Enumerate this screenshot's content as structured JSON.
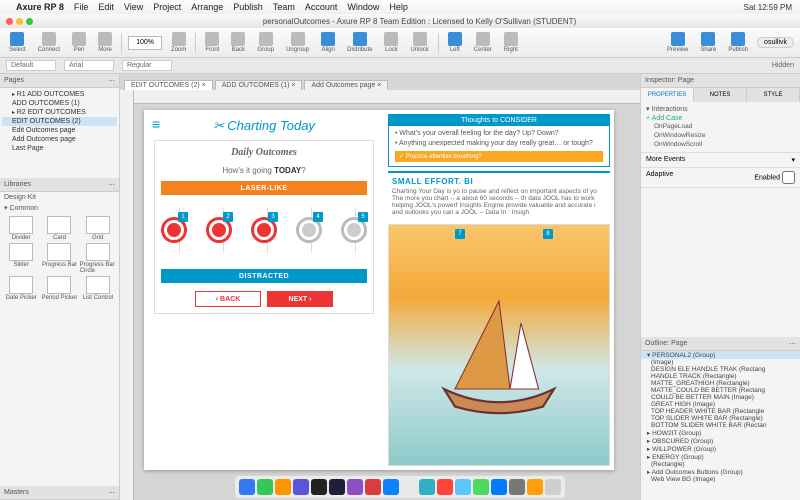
{
  "menubar": {
    "app": "Axure RP 8",
    "items": [
      "File",
      "Edit",
      "View",
      "Project",
      "Arrange",
      "Publish",
      "Team",
      "Account",
      "Window",
      "Help"
    ],
    "clock": "Sat 12:59 PM"
  },
  "window": {
    "title": "personalOutcomes - Axure RP 8 Team Edition : Licensed to Kelly O'Sullivan (STUDENT)"
  },
  "toolbar": {
    "buttons": [
      "Select",
      "Connect",
      "Pen",
      "More"
    ],
    "zoom": "100%",
    "mid": [
      "Zoom",
      "Front",
      "Back",
      "Group",
      "Ungroup",
      "Align",
      "Distribute",
      "Lock",
      "Unlock"
    ],
    "align": [
      "Left",
      "Center",
      "Right"
    ],
    "right": [
      "Preview",
      "Share",
      "Publish"
    ],
    "user": "osullivk"
  },
  "format": {
    "style": "Default",
    "font": "Arial",
    "weight": "Regular",
    "hidden": "Hidden"
  },
  "pages": {
    "title": "Pages",
    "items": [
      {
        "label": "R1 ADD OUTCOMES",
        "folder": true
      },
      {
        "label": "ADD OUTCOMES (1)"
      },
      {
        "label": "R2 EDIT OUTCOMES",
        "folder": true
      },
      {
        "label": "EDIT OUTCOMES (2)",
        "sel": true
      },
      {
        "label": "Edit Outcomes page"
      },
      {
        "label": "Add Outcomes page"
      },
      {
        "label": "Last Page"
      }
    ]
  },
  "libraries": {
    "title": "Libraries",
    "kit": "Design Kit",
    "group": "Common",
    "items": [
      "Divider",
      "Card",
      "Grid",
      "Slider",
      "Progress Bar",
      "Progress Bar Circle",
      "Date Picker",
      "Period Picker",
      "List Control"
    ]
  },
  "masters": {
    "title": "Masters"
  },
  "tabs": [
    {
      "label": "EDIT OUTCOMES (2)",
      "active": true,
      "x": true
    },
    {
      "label": "ADD OUTCOMES (1)",
      "x": true
    },
    {
      "label": "Add Outcomes page",
      "x": true
    }
  ],
  "artboard": {
    "logo": "Charting Today",
    "card_title": "Daily Outcomes",
    "prompt_pre": "How's it going ",
    "prompt_bold": "TODAY",
    "prompt_post": "?",
    "top_bar": "LASER-LIKE",
    "bottom_bar": "DISTRACTED",
    "icons": [
      {
        "n": "1",
        "on": true
      },
      {
        "n": "2",
        "on": true
      },
      {
        "n": "3",
        "on": true
      },
      {
        "n": "4",
        "on": false
      },
      {
        "n": "5",
        "on": false
      }
    ],
    "back": "‹ BACK",
    "next": "NEXT ›",
    "thoughts_head": "Thoughts to CONSIDER",
    "thoughts": [
      "• What's your overall feeling for the day? Up? Down?",
      "• Anything unexpected making your day really great… or tough?"
    ],
    "practice": "✓ Practice attentive breathing?",
    "effort_title": "SMALL EFFORT. BI",
    "effort_body": "Charting Your Day is yo to pause and reflect on important aspects of yo The more you chart -- a about 60 seconds -- th data JOOL has to work helping JOOL's powerf Insights Engine provide valuable and accurate i and outlooks you can a JOOL -- Data In : Insigh",
    "boat_badges": [
      "7",
      "8"
    ]
  },
  "inspector": {
    "title": "Inspector: Page",
    "tabs": [
      "PROPERTIES",
      "NOTES",
      "STYLE"
    ],
    "interactions_hdr": "▾ Interactions",
    "add_case": "+ Add Case",
    "events": [
      "OnPageLoad",
      "OnWindowResize",
      "OnWindowScroll"
    ],
    "more_events": "More Events",
    "adaptive": "Adaptive",
    "enabled": "Enabled"
  },
  "outline": {
    "title": "Outline: Page",
    "rows": [
      {
        "t": "▾ PERSONAL2 (Group)",
        "g": true,
        "sel": true
      },
      {
        "t": "(Image)"
      },
      {
        "t": "DESIGN ELE HANDLE TRAK (Rectang"
      },
      {
        "t": "HANDLE TRACK (Rectangle)"
      },
      {
        "t": "MATTE_GREATHIGH (Rectangle)"
      },
      {
        "t": "MATTE_COULD BE BETTER (Rectang"
      },
      {
        "t": "COULD BE BETTER MAIN (Image)"
      },
      {
        "t": "GREAT HIGH (Image)"
      },
      {
        "t": "TOP HEADER WHITE BAR (Rectangle"
      },
      {
        "t": "TOP SLIDER WHITE BAR (Rectangle)"
      },
      {
        "t": "BOTTOM SLIDER WHITE BAR (Rectan"
      },
      {
        "t": "▸ HOW2IT (Group)",
        "g": true
      },
      {
        "t": "▸ OBSCURED (Group)",
        "g": true
      },
      {
        "t": "▸ WILLPOWER (Group)",
        "g": true
      },
      {
        "t": "▸ ENERGY (Group)",
        "g": true
      },
      {
        "t": "(Rectangle)"
      },
      {
        "t": "▸ Add Outcomes Buttons (Group)",
        "g": true
      },
      {
        "t": "Web View BG (Image)"
      }
    ]
  },
  "dock_colors": [
    "#3478f6",
    "#34c759",
    "#ff9500",
    "#5856d6",
    "#222",
    "#1f1f3d",
    "#8e4ec6",
    "#d83e3e",
    "#0a84ff",
    "#e8e8e8",
    "#30b0c7",
    "#ff453a",
    "#5ac8fa",
    "#4cd964",
    "#007aff",
    "#777",
    "#ff9f0a",
    "#cfcfcf"
  ]
}
